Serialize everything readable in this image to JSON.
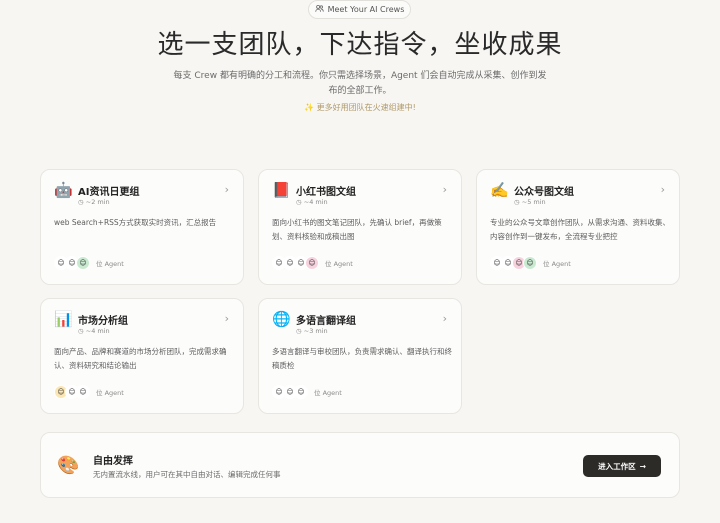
{
  "hero": {
    "pill_label": "Meet Your AI Crews",
    "title": "选一支团队，下达指令，坐收成果",
    "description": "每支 Crew 都有明确的分工和流程。你只需选择场景，Agent 们会自动完成从采集、创作到发布的全部工作。",
    "note": "✨ 更多好用团队在火速组建中!"
  },
  "crews": [
    {
      "icon": "🤖",
      "icon_name": "robot-icon",
      "title": "AI资讯日更组",
      "time": "~2 min",
      "description": "web Search+RSS方式获取实时资讯，汇总报告",
      "agent_count": "位 Agent",
      "avatars": [
        "#ffffff",
        "#ffffff",
        "#c9ead0"
      ]
    },
    {
      "icon": "📕",
      "icon_name": "red-book-icon",
      "title": "小红书图文组",
      "time": "~4 min",
      "description": "面向小红书的图文笔记团队，先确认 brief，再做策划、资料核验和成稿出图",
      "agent_count": "位 Agent",
      "avatars": [
        "#ffffff",
        "#ffffff",
        "#ffffff",
        "#f6d2de"
      ]
    },
    {
      "icon": "✍️",
      "icon_name": "writing-hand-icon",
      "title": "公众号图文组",
      "time": "~5 min",
      "description": "专业的公众号文章创作团队，从需求沟通、资料收集、内容创作到一键发布，全流程专业把控",
      "agent_count": "位 Agent",
      "avatars": [
        "#ffffff",
        "#ffffff",
        "#f6d2de",
        "#c9ead0"
      ]
    },
    {
      "icon": "📊",
      "icon_name": "bar-chart-icon",
      "title": "市场分析组",
      "time": "~4 min",
      "description": "面向产品、品牌和赛道的市场分析团队，完成需求确认、资料研究和结论输出",
      "agent_count": "位 Agent",
      "avatars": [
        "#fbe7b4",
        "#ffffff",
        "#ffffff"
      ]
    },
    {
      "icon": "🌐",
      "icon_name": "globe-icon",
      "title": "多语言翻译组",
      "time": "~3 min",
      "description": "多语言翻译与审校团队，负责需求确认、翻译执行和终稿质检",
      "agent_count": "位 Agent",
      "avatars": [
        "#ffffff",
        "#ffffff",
        "#ffffff"
      ]
    }
  ],
  "free_mode": {
    "icon": "🎨",
    "icon_name": "palette-icon",
    "title": "自由发挥",
    "description": "无内置流水线，用户可在其中自由对话、编辑完成任何事",
    "button_label": "进入工作区",
    "button_arrow": "→"
  },
  "colors": {
    "background": "#f7f6f3",
    "card": "#fcfcfb",
    "primary_button": "#2d2b28",
    "note": "#b09a6a"
  }
}
